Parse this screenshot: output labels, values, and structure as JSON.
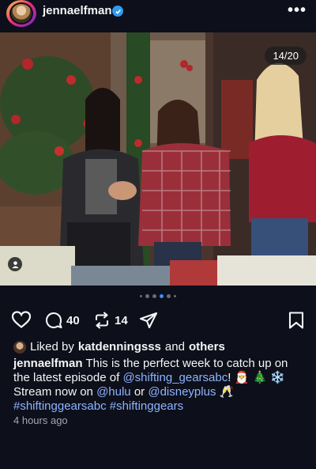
{
  "header": {
    "username": "jennaelfman",
    "more_label": "•••"
  },
  "photo": {
    "counter": "14/20"
  },
  "carousel": {
    "total_dots": 6,
    "active_index": 3
  },
  "actions": {
    "comments_count": "40",
    "reposts_count": "14"
  },
  "likes": {
    "prefix": "Liked by",
    "user": "katdenningsss",
    "conjunction": "and",
    "others": "others"
  },
  "caption": {
    "user": "jennaelfman",
    "text_1": "This is the perfect week to catch up on the latest episode of",
    "mention_1": "@shifting_gearsabc",
    "text_2": "!",
    "emoji_1": "🎅",
    "emoji_2": "🎄",
    "emoji_3": "❄️",
    "text_3": "Stream now on",
    "mention_2": "@hulu",
    "text_4": "or",
    "mention_3": "@disneyplus",
    "emoji_4": "🥂",
    "hashtag_1": "#shiftinggearsabc",
    "hashtag_2": "#shiftinggears"
  },
  "timestamp": "4 hours ago",
  "colors": {
    "background": "#0d0f1b",
    "link": "#8db4ff",
    "verified": "#2f9bf0",
    "active_dot": "#3f8cf7"
  }
}
